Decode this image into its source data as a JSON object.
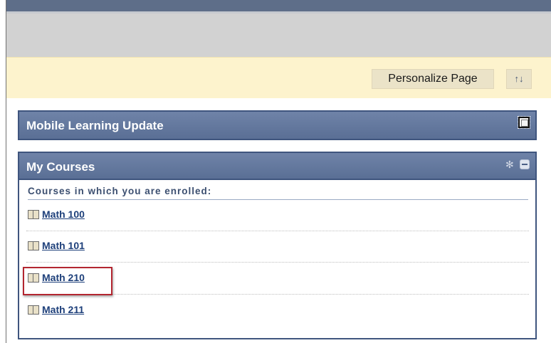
{
  "toolbar": {
    "personalize_label": "Personalize Page",
    "reorder_icon": "↑↓"
  },
  "modules": {
    "mobile": {
      "title": "Mobile Learning Update"
    },
    "courses": {
      "title": "My Courses",
      "heading": "Courses in which you are enrolled:",
      "items": [
        {
          "label": "Math 100"
        },
        {
          "label": "Math 101"
        },
        {
          "label": "Math 210",
          "highlighted": true
        },
        {
          "label": "Math 211"
        }
      ]
    }
  },
  "colors": {
    "header_bar": "#5e6e89",
    "action_bar": "#fdf3cd",
    "module_header": "#647aa0",
    "link": "#1d3f7a",
    "highlight": "#b32630"
  }
}
